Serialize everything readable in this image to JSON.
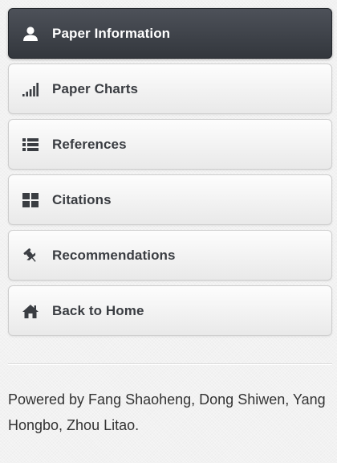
{
  "nav": {
    "items": [
      {
        "label": "Paper Information",
        "icon": "user-icon",
        "active": true
      },
      {
        "label": "Paper Charts",
        "icon": "signal-icon",
        "active": false
      },
      {
        "label": "References",
        "icon": "list-icon",
        "active": false
      },
      {
        "label": "Citations",
        "icon": "grid-icon",
        "active": false
      },
      {
        "label": "Recommendations",
        "icon": "pushpin-icon",
        "active": false
      },
      {
        "label": "Back to Home",
        "icon": "home-icon",
        "active": false
      }
    ]
  },
  "footer": {
    "text": "Powered by Fang Shaoheng, Dong Shiwen, Yang Hongbo, Zhou Litao."
  },
  "colors": {
    "active_bg": "#3f434a",
    "icon": "#3a3d42",
    "active_text": "#ffffff"
  }
}
